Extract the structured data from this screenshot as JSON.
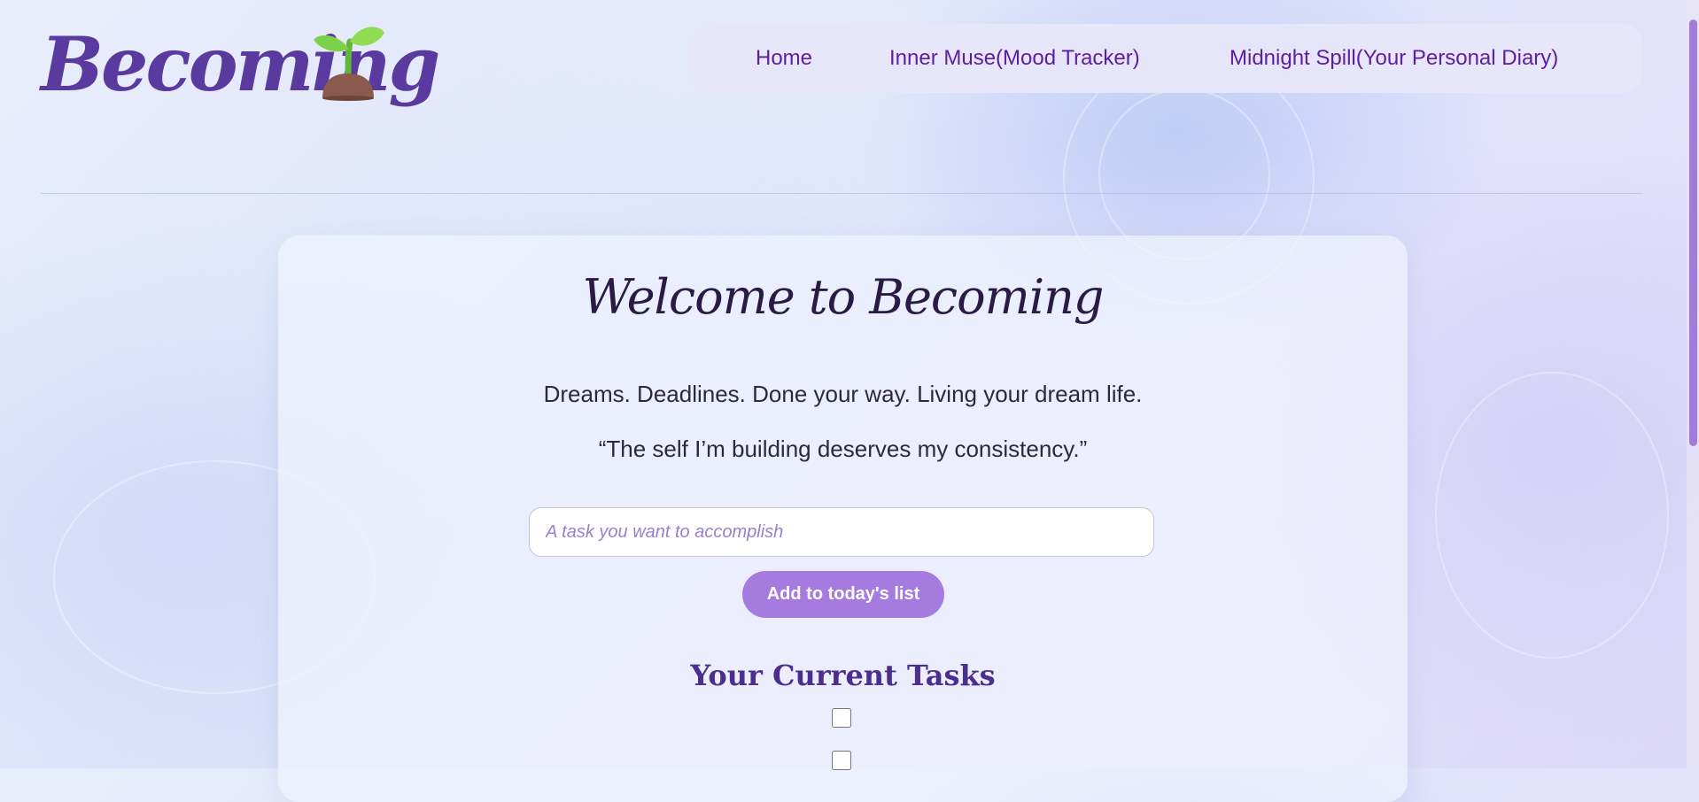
{
  "header": {
    "logo_text": "Becoming",
    "logo_emoji": "seedling-icon"
  },
  "nav": {
    "items": [
      {
        "label": "Home"
      },
      {
        "label": "Inner Muse(Mood Tracker)"
      },
      {
        "label": "Midnight Spill(Your Personal Diary)"
      }
    ]
  },
  "main": {
    "title": "Welcome to Becoming",
    "tagline": "Dreams. Deadlines. Done your way. Living your dream life.",
    "quote": "“The self I’m building deserves my consistency.”",
    "task_input": {
      "value": "",
      "placeholder": "A task you want to accomplish"
    },
    "add_button_label": "Add to today's list",
    "tasks_heading": "Your Current Tasks",
    "tasks": [
      {
        "checked": false
      },
      {
        "checked": false
      }
    ]
  },
  "colors": {
    "brand": "#5a3a9e",
    "nav_text": "#5b1fa3",
    "button": "#a67be0",
    "scrollbar_thumb": "#a37cd9"
  }
}
